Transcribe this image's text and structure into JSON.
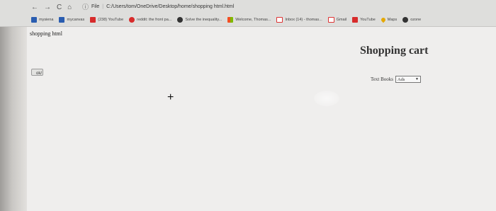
{
  "browser": {
    "nav_back": "←",
    "nav_forward": "→",
    "nav_reload": "C",
    "nav_home": "⌂",
    "address_info": "ⓘ",
    "address_scheme": "File",
    "address_url": "C:/Users/tom/OneDrive/Desktop/home/shopping html.html",
    "bookmarks": [
      {
        "label": "mysiena",
        "icon": "siena-icon"
      },
      {
        "label": "mycanvas",
        "icon": "canvas-icon"
      },
      {
        "label": "(238) YouTube",
        "icon": "youtube-icon"
      },
      {
        "label": "reddit: the front pa...",
        "icon": "reddit-icon"
      },
      {
        "label": "Solve the inequality...",
        "icon": "web-icon"
      },
      {
        "label": "Welcome, Thomas...",
        "icon": "windows-icon"
      },
      {
        "label": "Inbox (14) - thomas...",
        "icon": "gmail-icon"
      },
      {
        "label": "Gmail",
        "icon": "gmail-icon"
      },
      {
        "label": "YouTube",
        "icon": "youtube-icon"
      },
      {
        "label": "Maps",
        "icon": "maps-icon"
      },
      {
        "label": "ozone",
        "icon": "web-icon"
      }
    ]
  },
  "page": {
    "doc_label": "shopping html",
    "ok_button": "ok/",
    "title": "Shopping cart",
    "filter_label": "Text Books",
    "filter_selected": "Ads",
    "cursor_glyph": "+"
  }
}
